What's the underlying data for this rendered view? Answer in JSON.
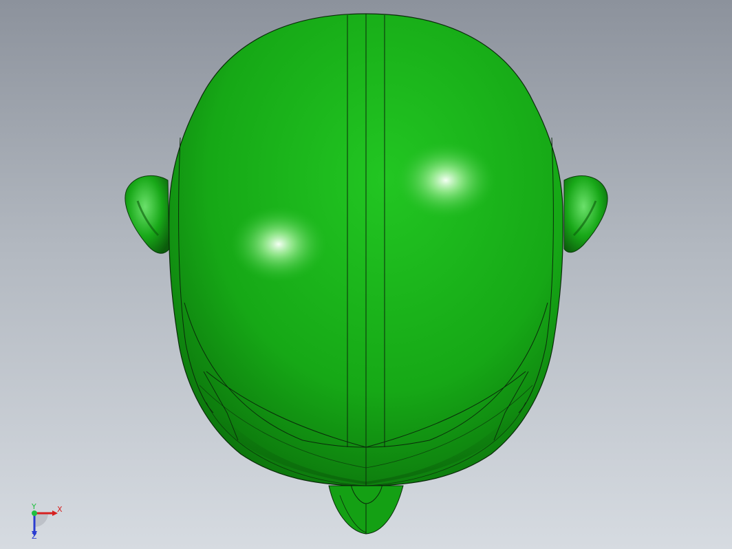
{
  "viewport": {
    "background_top": "#8c929c",
    "background_bottom": "#d6dbe1"
  },
  "model": {
    "body_color": "#19b019",
    "body_dark": "#0c6a0c",
    "highlight": "#eaffea",
    "edge_color": "#0a2a0a"
  },
  "triad": {
    "x_label": "X",
    "y_label": "Y",
    "z_label": "Z",
    "x_color": "#d62020",
    "y_color": "#20c040",
    "z_color": "#2a3cd0"
  }
}
